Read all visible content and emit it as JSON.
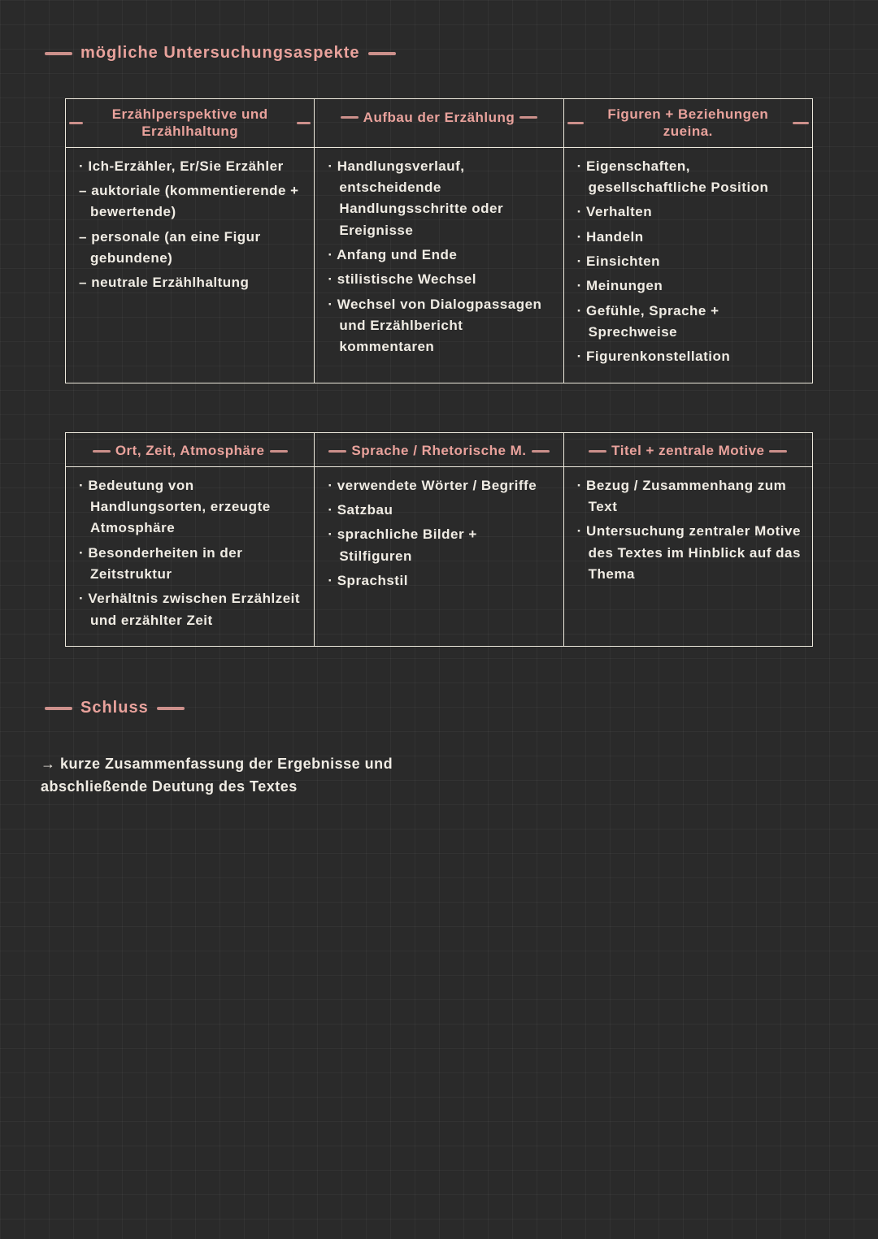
{
  "heading": "mögliche Untersuchungsaspekte",
  "table1": {
    "headers": [
      "Erzählperspektive und Erzählhaltung",
      "Aufbau der Erzählung",
      "Figuren + Beziehungen zueina."
    ],
    "col1": [
      "Ich-Erzähler, Er/Sie Erzähler",
      "auktoriale (kommentierende + bewertende)",
      "personale (an eine Figur gebundene)",
      "neutrale Erzählhaltung"
    ],
    "col2": [
      "Handlungsverlauf, entscheidende Handlungsschritte oder Ereignisse",
      "Anfang und Ende",
      "stilistische Wechsel",
      "Wechsel von Dialogpassagen und Erzählbericht kommentaren"
    ],
    "col3": [
      "Eigenschaften, gesellschaftliche Position",
      "Verhalten",
      "Handeln",
      "Einsichten",
      "Meinungen",
      "Gefühle, Sprache + Sprechweise",
      "Figurenkonstellation"
    ]
  },
  "table2": {
    "headers": [
      "Ort, Zeit, Atmosphäre",
      "Sprache / Rhetorische M.",
      "Titel + zentrale Motive"
    ],
    "col1": [
      "Bedeutung von Handlungsorten, erzeugte Atmosphäre",
      "Besonderheiten in der Zeitstruktur",
      "Verhältnis zwischen Erzählzeit und erzählter Zeit"
    ],
    "col2": [
      "verwendete Wörter / Begriffe",
      "Satzbau",
      "sprachliche Bilder + Stilfiguren",
      "Sprachstil"
    ],
    "col3": [
      "Bezug / Zusammenhang zum Text",
      "Untersuchung zentraler Motive des Textes im Hinblick auf das Thema"
    ]
  },
  "schluss_heading": "Schluss",
  "summary": "→ kurze Zusammenfassung der Ergebnisse und abschließende Deutung des Textes"
}
